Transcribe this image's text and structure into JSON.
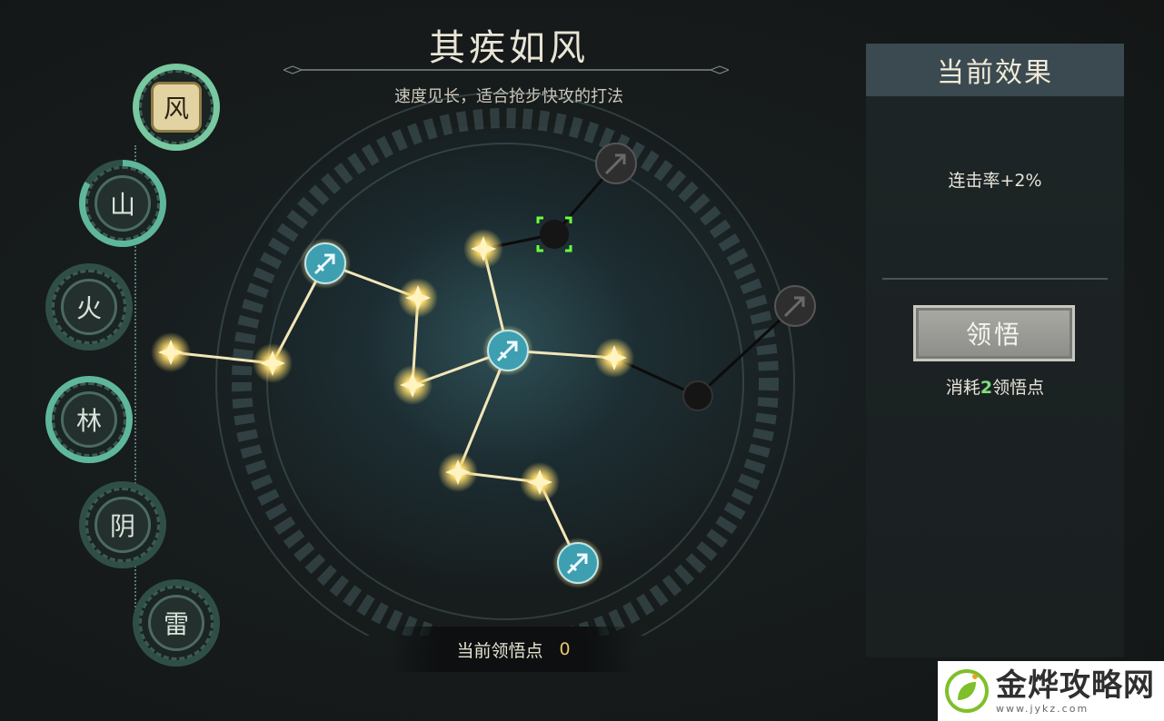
{
  "header": {
    "title": "其疾如风",
    "subtitle": "速度见长，适合抢步快攻的打法"
  },
  "categories": [
    {
      "label": "风",
      "active": true
    },
    {
      "label": "山",
      "active": false
    },
    {
      "label": "火",
      "active": false
    },
    {
      "label": "林",
      "active": false
    },
    {
      "label": "阴",
      "active": false
    },
    {
      "label": "雷",
      "active": false
    }
  ],
  "panel": {
    "heading": "当前效果",
    "effect_text": "连击率+2%",
    "button_label": "领悟",
    "cost_prefix": "消耗",
    "cost_value": "2",
    "cost_suffix": "领悟点"
  },
  "points": {
    "label": "当前领悟点",
    "value": "0"
  },
  "watermark": {
    "name": "金烨攻略网",
    "url": "www.jykz.com"
  },
  "colors": {
    "star_gold": "#f3d36a",
    "node_teal": "#3e9fb0",
    "locked_node": "#2e2e2e",
    "selection_green": "#6cff3a"
  }
}
